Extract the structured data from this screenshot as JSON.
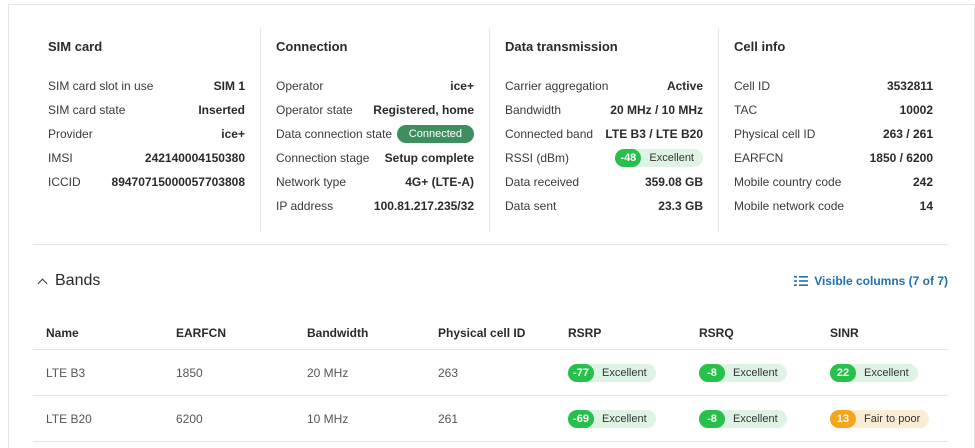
{
  "sim_card": {
    "title": "SIM card",
    "rows": [
      {
        "label": "SIM card slot in use",
        "value": "SIM 1"
      },
      {
        "label": "SIM card state",
        "value": "Inserted"
      },
      {
        "label": "Provider",
        "value": "ice+"
      },
      {
        "label": "IMSI",
        "value": "242140004150380"
      },
      {
        "label": "ICCID",
        "value": "89470715000057703808"
      }
    ]
  },
  "connection": {
    "title": "Connection",
    "rows": [
      {
        "label": "Operator",
        "value": "ice+"
      },
      {
        "label": "Operator state",
        "value": "Registered, home"
      },
      {
        "label": "Data connection state",
        "value": "Connected"
      },
      {
        "label": "Connection stage",
        "value": "Setup complete"
      },
      {
        "label": "Network type",
        "value": "4G+ (LTE-A)"
      },
      {
        "label": "IP address",
        "value": "100.81.217.235/32"
      }
    ]
  },
  "data_transmission": {
    "title": "Data transmission",
    "rows": [
      {
        "label": "Carrier aggregation",
        "value": "Active"
      },
      {
        "label": "Bandwidth",
        "value": "20 MHz / 10 MHz"
      },
      {
        "label": "Connected band",
        "value": "LTE B3 / LTE B20"
      },
      {
        "label": "RSSI (dBm)",
        "value": "-48",
        "quality": "Excellent"
      },
      {
        "label": "Data received",
        "value": "359.08 GB"
      },
      {
        "label": "Data sent",
        "value": "23.3 GB"
      }
    ]
  },
  "cell_info": {
    "title": "Cell info",
    "rows": [
      {
        "label": "Cell ID",
        "value": "3532811"
      },
      {
        "label": "TAC",
        "value": "10002"
      },
      {
        "label": "Physical cell ID",
        "value": "263 / 261"
      },
      {
        "label": "EARFCN",
        "value": "1850 / 6200"
      },
      {
        "label": "Mobile country code",
        "value": "242"
      },
      {
        "label": "Mobile network code",
        "value": "14"
      }
    ]
  },
  "bands": {
    "title": "Bands",
    "visible_columns_label": "Visible columns (7 of 7)",
    "columns": [
      "Name",
      "EARFCN",
      "Bandwidth",
      "Physical cell ID",
      "RSRP",
      "RSRQ",
      "SINR"
    ],
    "rows": [
      {
        "name": "LTE B3",
        "earfcn": "1850",
        "bandwidth": "20 MHz",
        "pci": "263",
        "rsrp": {
          "value": "-77",
          "quality": "Excellent"
        },
        "rsrq": {
          "value": "-8",
          "quality": "Excellent"
        },
        "sinr": {
          "value": "22",
          "quality": "Excellent"
        }
      },
      {
        "name": "LTE B20",
        "earfcn": "6200",
        "bandwidth": "10 MHz",
        "pci": "261",
        "rsrp": {
          "value": "-69",
          "quality": "Excellent"
        },
        "rsrq": {
          "value": "-8",
          "quality": "Excellent"
        },
        "sinr": {
          "value": "13",
          "quality": "Fair to poor"
        }
      }
    ]
  },
  "colors": {
    "connected_pill": "#3e8e5e",
    "excellent": "#26c04a",
    "fair_to_poor": "#f4a51c",
    "link": "#1f6fb2"
  },
  "icons": {
    "bands_toggle": "chevron-up-icon",
    "visible_columns": "columns-icon"
  }
}
